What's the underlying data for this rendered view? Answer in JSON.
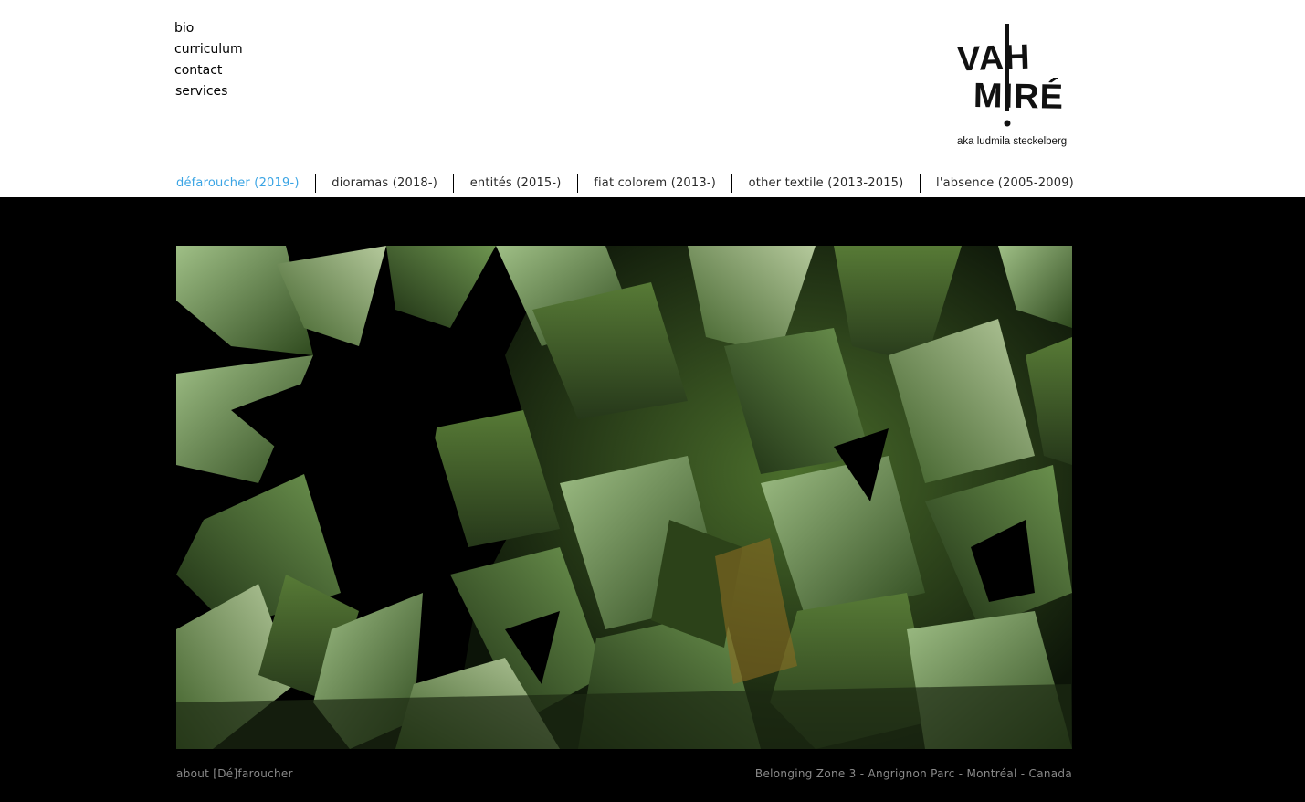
{
  "side_menu": {
    "items": [
      {
        "label": "bio"
      },
      {
        "label": "curriculum"
      },
      {
        "label": "contact"
      },
      {
        "label": "services"
      }
    ]
  },
  "logo": {
    "line1": "VAH",
    "line2": "MIRÉ",
    "tagline": "aka ludmila steckelberg"
  },
  "topnav": {
    "active_color": "#3aa4e4",
    "items": [
      {
        "label": "défaroucher (2019-)",
        "active": true
      },
      {
        "label": "dioramas (2018-)"
      },
      {
        "label": "entités (2015-)"
      },
      {
        "label": "fiat colorem (2013-)"
      },
      {
        "label": "other textile (2013-2015)"
      },
      {
        "label": "l'absence (2005-2009)"
      }
    ]
  },
  "gallery": {
    "image_alt": "",
    "about_link": "about [Dé]faroucher",
    "caption": "Belonging Zone 3 - Angrignon Parc - Montréal - Canada"
  }
}
